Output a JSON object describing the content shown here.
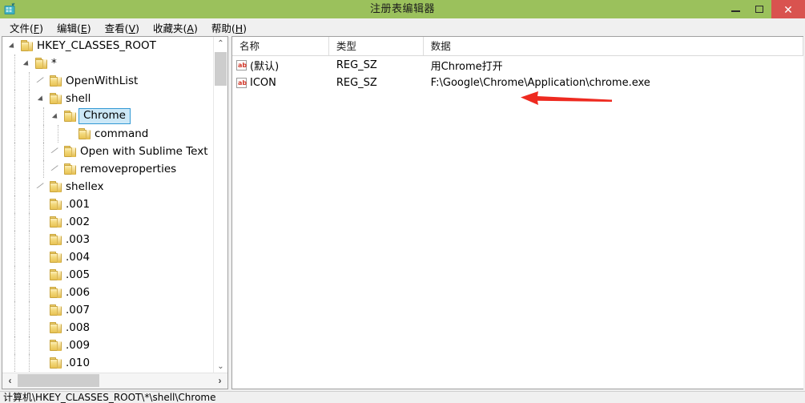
{
  "window": {
    "title": "注册表编辑器",
    "app_icon": "registry-editor-icon",
    "titlebar_color": "#9bc15c",
    "close_button_color": "#d9534f",
    "controls": {
      "minimize": "minimize-icon",
      "maximize": "maximize-icon",
      "close": "✕"
    }
  },
  "menubar": {
    "items": [
      {
        "label": "文件(F)",
        "text": "文件(",
        "accel": "F",
        "tail": ")"
      },
      {
        "label": "编辑(E)",
        "text": "编辑(",
        "accel": "E",
        "tail": ")"
      },
      {
        "label": "查看(V)",
        "text": "查看(",
        "accel": "V",
        "tail": ")"
      },
      {
        "label": "收藏夹(A)",
        "text": "收藏夹(",
        "accel": "A",
        "tail": ")"
      },
      {
        "label": "帮助(H)",
        "text": "帮助(",
        "accel": "H",
        "tail": ")"
      }
    ]
  },
  "tree": {
    "selection_fill": "#cce8f7",
    "selection_border": "#3399d4",
    "nodes": [
      {
        "label": "HKEY_CLASSES_ROOT",
        "depth": 0,
        "state": "expanded",
        "selected": false
      },
      {
        "label": "*",
        "depth": 1,
        "state": "expanded",
        "selected": false
      },
      {
        "label": "OpenWithList",
        "depth": 2,
        "state": "collapsed",
        "selected": false
      },
      {
        "label": "shell",
        "depth": 2,
        "state": "expanded",
        "selected": false
      },
      {
        "label": "Chrome",
        "depth": 3,
        "state": "expanded",
        "selected": true
      },
      {
        "label": "command",
        "depth": 4,
        "state": "leaf",
        "selected": false
      },
      {
        "label": "Open with Sublime Text",
        "depth": 3,
        "state": "collapsed",
        "selected": false
      },
      {
        "label": "removeproperties",
        "depth": 3,
        "state": "collapsed",
        "selected": false
      },
      {
        "label": "shellex",
        "depth": 2,
        "state": "collapsed",
        "selected": false
      },
      {
        "label": ".001",
        "depth": 2,
        "state": "leaf",
        "selected": false
      },
      {
        "label": ".002",
        "depth": 2,
        "state": "leaf",
        "selected": false
      },
      {
        "label": ".003",
        "depth": 2,
        "state": "leaf",
        "selected": false
      },
      {
        "label": ".004",
        "depth": 2,
        "state": "leaf",
        "selected": false
      },
      {
        "label": ".005",
        "depth": 2,
        "state": "leaf",
        "selected": false
      },
      {
        "label": ".006",
        "depth": 2,
        "state": "leaf",
        "selected": false
      },
      {
        "label": ".007",
        "depth": 2,
        "state": "leaf",
        "selected": false
      },
      {
        "label": ".008",
        "depth": 2,
        "state": "leaf",
        "selected": false
      },
      {
        "label": ".009",
        "depth": 2,
        "state": "leaf",
        "selected": false
      },
      {
        "label": ".010",
        "depth": 2,
        "state": "leaf",
        "selected": false
      }
    ],
    "vscroll": {
      "up_arrow": "⌃",
      "down_arrow": "⌄"
    },
    "hscroll": {
      "left_arrow": "‹",
      "right_arrow": "›"
    }
  },
  "valuelist": {
    "columns": [
      {
        "label": "名称",
        "key": "name"
      },
      {
        "label": "类型",
        "key": "type"
      },
      {
        "label": "数据",
        "key": "data"
      }
    ],
    "rows": [
      {
        "icon": "string-value-icon",
        "icon_text": "ab",
        "name": "(默认)",
        "type": "REG_SZ",
        "data": "用Chrome打开"
      },
      {
        "icon": "string-value-icon",
        "icon_text": "ab",
        "name": "ICON",
        "type": "REG_SZ",
        "data": "F:\\Google\\Chrome\\Application\\chrome.exe"
      }
    ]
  },
  "annotation": {
    "arrow": "red-left-arrow",
    "color": "#ee2a20",
    "points_to": "用Chrome打开"
  },
  "statusbar": {
    "path": "计算机\\HKEY_CLASSES_ROOT\\*\\shell\\Chrome"
  }
}
